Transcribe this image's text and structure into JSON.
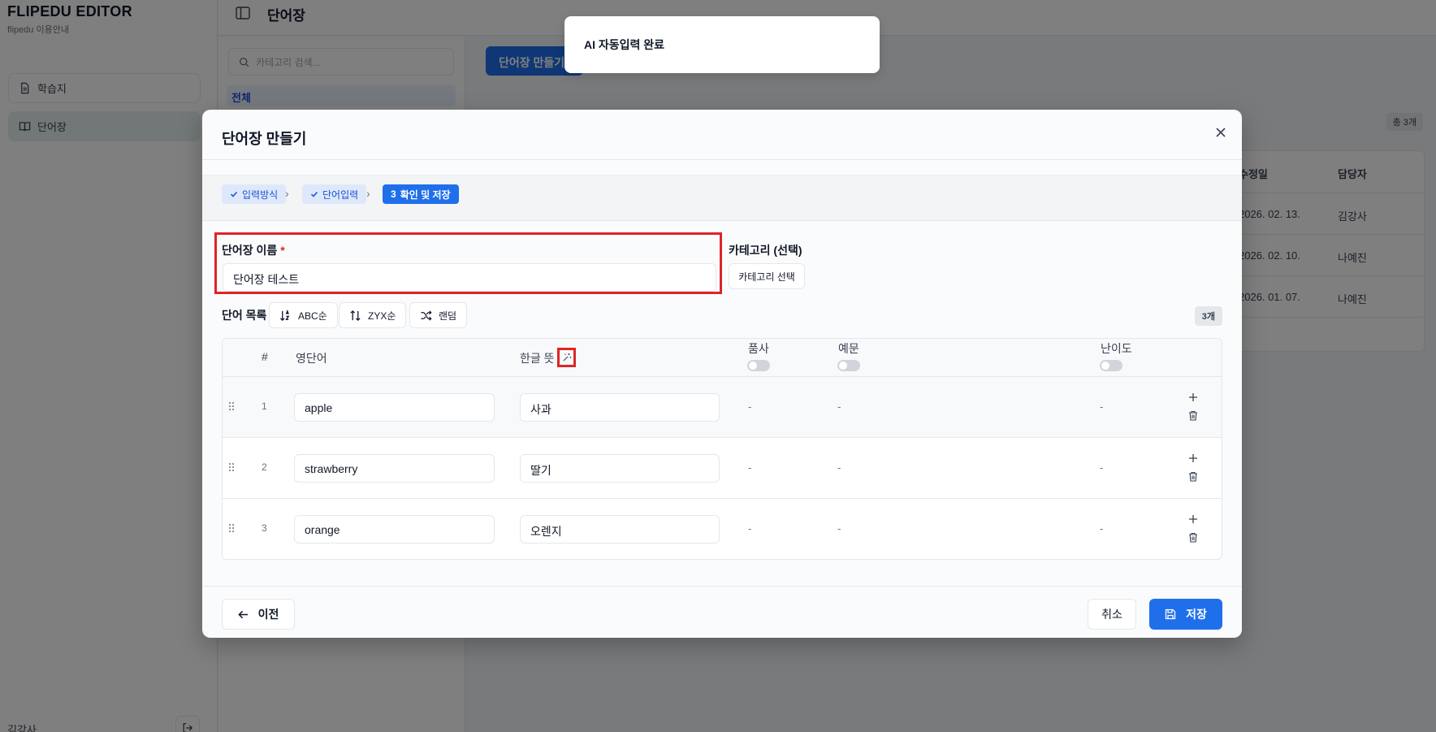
{
  "sidebar": {
    "brand_title": "FLIPEDU EDITOR",
    "brand_sub": "flipedu 이용안내",
    "items": [
      {
        "label": "학습지",
        "icon": "document-icon"
      },
      {
        "label": "단어장",
        "icon": "book-icon"
      }
    ],
    "user_name": "김강사"
  },
  "header": {
    "title": "단어장"
  },
  "category_panel": {
    "search_placeholder": "카테고리 검색...",
    "all_label": "전체"
  },
  "main": {
    "create_label": "단어장 만들기",
    "total_label": "총 3개",
    "columns": {
      "modified": "수정일",
      "owner": "담당자"
    },
    "rows": [
      {
        "modified": "2026. 02. 13.",
        "owner": "김강사"
      },
      {
        "modified": "2026. 02. 10.",
        "owner": "나예진"
      },
      {
        "modified": "2026. 01. 07.",
        "owner": "나예진"
      }
    ]
  },
  "toast": {
    "message": "AI 자동입력 완료"
  },
  "modal": {
    "title": "단어장 만들기",
    "steps": [
      {
        "label": "입력방식",
        "status": "done"
      },
      {
        "label": "단어입력",
        "status": "done"
      },
      {
        "number": "3",
        "label": "확인 및 저장",
        "status": "current"
      }
    ],
    "name_label": "단어장 이름",
    "required_mark": "*",
    "name_value": "단어장 테스트",
    "category_label": "카테고리 (선택)",
    "category_button": "카테고리 선택",
    "list_label": "단어 목록",
    "sort_buttons": [
      {
        "label": "ABC순",
        "icon": "sort-asc-icon"
      },
      {
        "label": "ZYX순",
        "icon": "sort-desc-icon"
      },
      {
        "label": "랜덤",
        "icon": "shuffle-icon"
      }
    ],
    "count_badge": "3개",
    "table_headers": {
      "num": "#",
      "english": "영단어",
      "korean": "한글 뜻",
      "pos": "품사",
      "example": "예문",
      "difficulty": "난이도"
    },
    "words": [
      {
        "num": "1",
        "english": "apple",
        "korean": "사과",
        "pos": "-",
        "example": "-",
        "difficulty": "-"
      },
      {
        "num": "2",
        "english": "strawberry",
        "korean": "딸기",
        "pos": "-",
        "example": "-",
        "difficulty": "-"
      },
      {
        "num": "3",
        "english": "orange",
        "korean": "오렌지",
        "pos": "-",
        "example": "-",
        "difficulty": "-"
      }
    ],
    "prev_label": "이전",
    "cancel_label": "취소",
    "save_label": "저장"
  },
  "colors": {
    "primary": "#1f6feb",
    "highlight_border": "#dc2626",
    "overlay": "rgba(0,0,0,0.5)"
  }
}
